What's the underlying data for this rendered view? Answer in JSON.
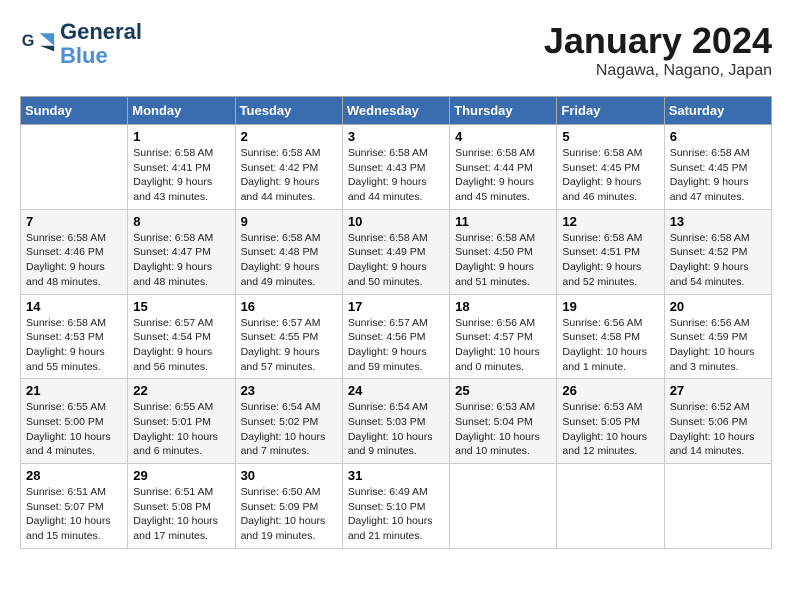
{
  "header": {
    "logo_line1": "General",
    "logo_line2": "Blue",
    "month_title": "January 2024",
    "location": "Nagawa, Nagano, Japan"
  },
  "days_of_week": [
    "Sunday",
    "Monday",
    "Tuesday",
    "Wednesday",
    "Thursday",
    "Friday",
    "Saturday"
  ],
  "weeks": [
    [
      {
        "day": "",
        "detail": ""
      },
      {
        "day": "1",
        "detail": "Sunrise: 6:58 AM\nSunset: 4:41 PM\nDaylight: 9 hours\nand 43 minutes."
      },
      {
        "day": "2",
        "detail": "Sunrise: 6:58 AM\nSunset: 4:42 PM\nDaylight: 9 hours\nand 44 minutes."
      },
      {
        "day": "3",
        "detail": "Sunrise: 6:58 AM\nSunset: 4:43 PM\nDaylight: 9 hours\nand 44 minutes."
      },
      {
        "day": "4",
        "detail": "Sunrise: 6:58 AM\nSunset: 4:44 PM\nDaylight: 9 hours\nand 45 minutes."
      },
      {
        "day": "5",
        "detail": "Sunrise: 6:58 AM\nSunset: 4:45 PM\nDaylight: 9 hours\nand 46 minutes."
      },
      {
        "day": "6",
        "detail": "Sunrise: 6:58 AM\nSunset: 4:45 PM\nDaylight: 9 hours\nand 47 minutes."
      }
    ],
    [
      {
        "day": "7",
        "detail": "Sunrise: 6:58 AM\nSunset: 4:46 PM\nDaylight: 9 hours\nand 48 minutes."
      },
      {
        "day": "8",
        "detail": "Sunrise: 6:58 AM\nSunset: 4:47 PM\nDaylight: 9 hours\nand 48 minutes."
      },
      {
        "day": "9",
        "detail": "Sunrise: 6:58 AM\nSunset: 4:48 PM\nDaylight: 9 hours\nand 49 minutes."
      },
      {
        "day": "10",
        "detail": "Sunrise: 6:58 AM\nSunset: 4:49 PM\nDaylight: 9 hours\nand 50 minutes."
      },
      {
        "day": "11",
        "detail": "Sunrise: 6:58 AM\nSunset: 4:50 PM\nDaylight: 9 hours\nand 51 minutes."
      },
      {
        "day": "12",
        "detail": "Sunrise: 6:58 AM\nSunset: 4:51 PM\nDaylight: 9 hours\nand 52 minutes."
      },
      {
        "day": "13",
        "detail": "Sunrise: 6:58 AM\nSunset: 4:52 PM\nDaylight: 9 hours\nand 54 minutes."
      }
    ],
    [
      {
        "day": "14",
        "detail": "Sunrise: 6:58 AM\nSunset: 4:53 PM\nDaylight: 9 hours\nand 55 minutes."
      },
      {
        "day": "15",
        "detail": "Sunrise: 6:57 AM\nSunset: 4:54 PM\nDaylight: 9 hours\nand 56 minutes."
      },
      {
        "day": "16",
        "detail": "Sunrise: 6:57 AM\nSunset: 4:55 PM\nDaylight: 9 hours\nand 57 minutes."
      },
      {
        "day": "17",
        "detail": "Sunrise: 6:57 AM\nSunset: 4:56 PM\nDaylight: 9 hours\nand 59 minutes."
      },
      {
        "day": "18",
        "detail": "Sunrise: 6:56 AM\nSunset: 4:57 PM\nDaylight: 10 hours\nand 0 minutes."
      },
      {
        "day": "19",
        "detail": "Sunrise: 6:56 AM\nSunset: 4:58 PM\nDaylight: 10 hours\nand 1 minute."
      },
      {
        "day": "20",
        "detail": "Sunrise: 6:56 AM\nSunset: 4:59 PM\nDaylight: 10 hours\nand 3 minutes."
      }
    ],
    [
      {
        "day": "21",
        "detail": "Sunrise: 6:55 AM\nSunset: 5:00 PM\nDaylight: 10 hours\nand 4 minutes."
      },
      {
        "day": "22",
        "detail": "Sunrise: 6:55 AM\nSunset: 5:01 PM\nDaylight: 10 hours\nand 6 minutes."
      },
      {
        "day": "23",
        "detail": "Sunrise: 6:54 AM\nSunset: 5:02 PM\nDaylight: 10 hours\nand 7 minutes."
      },
      {
        "day": "24",
        "detail": "Sunrise: 6:54 AM\nSunset: 5:03 PM\nDaylight: 10 hours\nand 9 minutes."
      },
      {
        "day": "25",
        "detail": "Sunrise: 6:53 AM\nSunset: 5:04 PM\nDaylight: 10 hours\nand 10 minutes."
      },
      {
        "day": "26",
        "detail": "Sunrise: 6:53 AM\nSunset: 5:05 PM\nDaylight: 10 hours\nand 12 minutes."
      },
      {
        "day": "27",
        "detail": "Sunrise: 6:52 AM\nSunset: 5:06 PM\nDaylight: 10 hours\nand 14 minutes."
      }
    ],
    [
      {
        "day": "28",
        "detail": "Sunrise: 6:51 AM\nSunset: 5:07 PM\nDaylight: 10 hours\nand 15 minutes."
      },
      {
        "day": "29",
        "detail": "Sunrise: 6:51 AM\nSunset: 5:08 PM\nDaylight: 10 hours\nand 17 minutes."
      },
      {
        "day": "30",
        "detail": "Sunrise: 6:50 AM\nSunset: 5:09 PM\nDaylight: 10 hours\nand 19 minutes."
      },
      {
        "day": "31",
        "detail": "Sunrise: 6:49 AM\nSunset: 5:10 PM\nDaylight: 10 hours\nand 21 minutes."
      },
      {
        "day": "",
        "detail": ""
      },
      {
        "day": "",
        "detail": ""
      },
      {
        "day": "",
        "detail": ""
      }
    ]
  ]
}
